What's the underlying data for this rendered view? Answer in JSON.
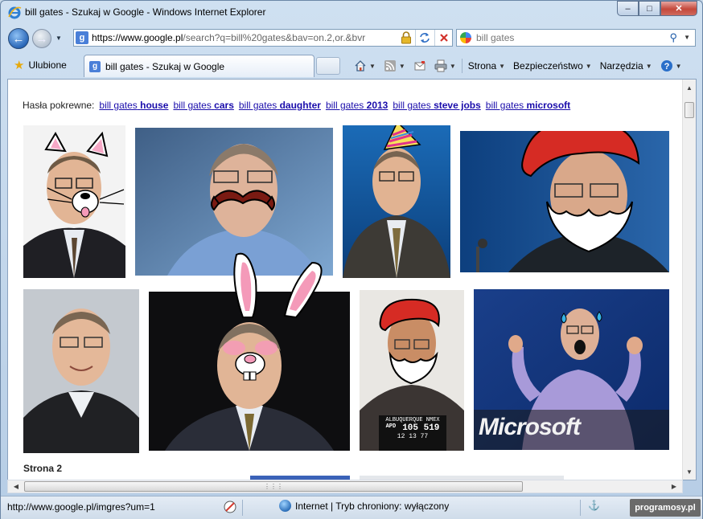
{
  "window": {
    "title": "bill gates - Szukaj w Google - Windows Internet Explorer",
    "minimize_glyph": "–",
    "maximize_glyph": "□",
    "close_glyph": "✕"
  },
  "address": {
    "url_main": "https://www.google.pl",
    "url_rest": "/search?q=bill%20gates&bav=on.2,or.&bvr",
    "lock_icon": "padlock-icon",
    "refresh_icon": "refresh-icon",
    "stop_icon": "stop-icon"
  },
  "search": {
    "value": "bill gates"
  },
  "favorites": {
    "label": "Ulubione"
  },
  "tab": {
    "label": "bill gates - Szukaj w Google"
  },
  "commands": {
    "home_icon": "home-icon",
    "rss_icon": "rss-icon",
    "mail_icon": "mail-icon",
    "print_icon": "print-icon",
    "page_label": "Strona",
    "safety_label": "Bezpieczeństwo",
    "tools_label": "Narzędzia",
    "help_icon": "help-icon"
  },
  "related": {
    "prefix": "Hasła pokrewne:",
    "links": [
      {
        "base": "bill gates",
        "bold": "house"
      },
      {
        "base": "bill gates",
        "bold": "cars"
      },
      {
        "base": "bill gates",
        "bold": "daughter"
      },
      {
        "base": "bill gates",
        "bold": "2013"
      },
      {
        "base": "bill gates",
        "bold": "steve jobs"
      },
      {
        "base": "bill gates",
        "bold": "microsoft"
      }
    ]
  },
  "images": {
    "mugshot_sign_top": "ALBUQUERQUE  NMEX",
    "mugshot_sign_apd": "APD",
    "mugshot_sign_num": "105 519",
    "mugshot_sign_date": "12 13 77",
    "microsoft_logo": "Microsoft"
  },
  "page2": {
    "label": "Strona 2"
  },
  "statusbar": {
    "url": "http://www.google.pl/imgres?um=1",
    "zone": "Internet | Tryb chroniony: wyłączony",
    "zoom_glyph": "⚓"
  },
  "watermark": {
    "text": "programosy.pl"
  },
  "colors": {
    "link": "#1a0dab",
    "titlebar": "#cfe0f1",
    "close_button": "#c4483b"
  }
}
